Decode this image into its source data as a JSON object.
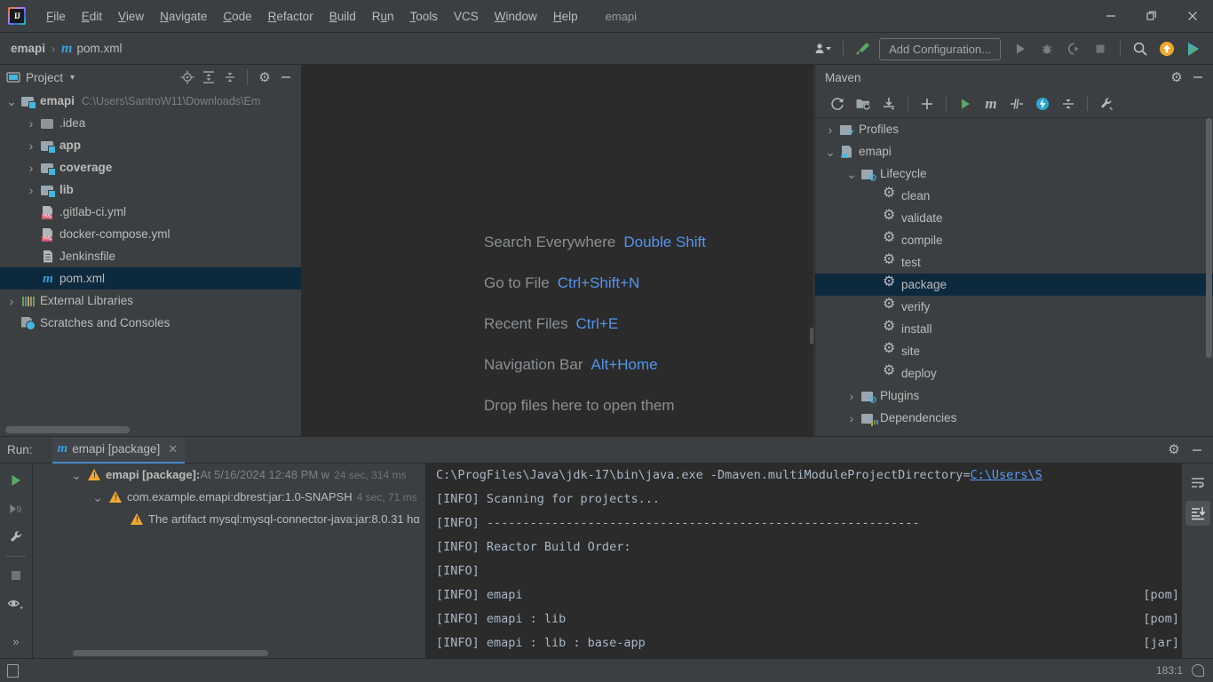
{
  "window": {
    "app_icon": "intellij-idea-logo",
    "project_name": "emapi",
    "menus": [
      {
        "label": "File",
        "accel": "F"
      },
      {
        "label": "Edit",
        "accel": "E"
      },
      {
        "label": "View",
        "accel": "V"
      },
      {
        "label": "Navigate",
        "accel": "N"
      },
      {
        "label": "Code",
        "accel": "C"
      },
      {
        "label": "Refactor",
        "accel": "R"
      },
      {
        "label": "Build",
        "accel": "B"
      },
      {
        "label": "Run",
        "accel": "u"
      },
      {
        "label": "Tools",
        "accel": "T"
      },
      {
        "label": "VCS",
        "accel": ""
      },
      {
        "label": "Window",
        "accel": "W"
      },
      {
        "label": "Help",
        "accel": "H"
      }
    ],
    "controls": {
      "minimize": "—",
      "restore": "❐",
      "close": "✕"
    }
  },
  "navbar": {
    "breadcrumb_root": "emapi",
    "breadcrumb_sep": "›",
    "breadcrumb_file": "pom.xml",
    "file_icon": "maven-file-icon",
    "add_configuration": "Add Configuration...",
    "icons": {
      "user": "user-dropdown-icon",
      "build": "build-hammer-icon",
      "run": "run-icon",
      "debug": "debug-icon",
      "run_coverage": "run-with-coverage-icon",
      "stop": "stop-icon",
      "search": "search-icon",
      "updates": "update-available-icon",
      "ide_feature": "ide-feature-trainer-icon"
    }
  },
  "project_panel": {
    "title": "Project",
    "dropdown": "▾",
    "actions": [
      "locate-icon",
      "expand-all-icon",
      "collapse-all-icon",
      "settings-gear-icon",
      "hide-icon"
    ],
    "tree": [
      {
        "label": "emapi",
        "hint": "C:\\Users\\SantroW11\\Downloads\\Em",
        "icon": "module-folder-icon",
        "indent": 0,
        "arrow": "expanded",
        "bold": true,
        "selected": false
      },
      {
        "label": ".idea",
        "hint": "",
        "icon": "folder-icon",
        "indent": 1,
        "arrow": "collapsed",
        "bold": false,
        "selected": false
      },
      {
        "label": "app",
        "hint": "",
        "icon": "module-folder-icon",
        "indent": 1,
        "arrow": "collapsed",
        "bold": true,
        "selected": false
      },
      {
        "label": "coverage",
        "hint": "",
        "icon": "module-folder-icon",
        "indent": 1,
        "arrow": "collapsed",
        "bold": true,
        "selected": false
      },
      {
        "label": "lib",
        "hint": "",
        "icon": "module-folder-icon",
        "indent": 1,
        "arrow": "collapsed",
        "bold": true,
        "selected": false
      },
      {
        "label": ".gitlab-ci.yml",
        "hint": "",
        "icon": "yml-file-icon",
        "indent": 1,
        "arrow": "none",
        "bold": false,
        "selected": false
      },
      {
        "label": "docker-compose.yml",
        "hint": "",
        "icon": "yml-file-icon",
        "indent": 1,
        "arrow": "none",
        "bold": false,
        "selected": false
      },
      {
        "label": "Jenkinsfile",
        "hint": "",
        "icon": "text-file-icon",
        "indent": 1,
        "arrow": "none",
        "bold": false,
        "selected": false
      },
      {
        "label": "pom.xml",
        "hint": "",
        "icon": "maven-file-icon",
        "indent": 1,
        "arrow": "none",
        "bold": false,
        "selected": true
      },
      {
        "label": "External Libraries",
        "hint": "",
        "icon": "libraries-icon",
        "indent": 0,
        "arrow": "collapsed",
        "bold": false,
        "selected": false
      },
      {
        "label": "Scratches and Consoles",
        "hint": "",
        "icon": "scratches-icon",
        "indent": 0,
        "arrow": "none",
        "bold": false,
        "selected": false
      }
    ]
  },
  "editor": {
    "tips": [
      {
        "label": "Search Everywhere",
        "key": "Double Shift"
      },
      {
        "label": "Go to File",
        "key": "Ctrl+Shift+N"
      },
      {
        "label": "Recent Files",
        "key": "Ctrl+E"
      },
      {
        "label": "Navigation Bar",
        "key": "Alt+Home"
      },
      {
        "label": "Drop files here to open them",
        "key": ""
      }
    ]
  },
  "maven_panel": {
    "title": "Maven",
    "header_actions": [
      "settings-gear-icon",
      "hide-icon"
    ],
    "toolbar": [
      "reload-all-maven-projects-icon",
      "add-maven-project-icon",
      "download-sources-icon",
      "add-icon",
      "run-icon",
      "execute-maven-goal-icon",
      "toggle-skip-tests-icon",
      "toggle-offline-mode-icon",
      "collapse-all-icon",
      "maven-settings-icon"
    ],
    "tree": [
      {
        "label": "Profiles",
        "icon": "profiles-icon",
        "indent": 0,
        "arrow": "collapsed",
        "selected": false
      },
      {
        "label": "emapi",
        "icon": "maven-module-icon",
        "indent": 0,
        "arrow": "expanded",
        "selected": false
      },
      {
        "label": "Lifecycle",
        "icon": "lifecycle-folder-icon",
        "indent": 1,
        "arrow": "expanded",
        "selected": false
      },
      {
        "label": "clean",
        "icon": "maven-goal-icon",
        "indent": 2,
        "arrow": "none",
        "selected": false
      },
      {
        "label": "validate",
        "icon": "maven-goal-icon",
        "indent": 2,
        "arrow": "none",
        "selected": false
      },
      {
        "label": "compile",
        "icon": "maven-goal-icon",
        "indent": 2,
        "arrow": "none",
        "selected": false
      },
      {
        "label": "test",
        "icon": "maven-goal-icon",
        "indent": 2,
        "arrow": "none",
        "selected": false
      },
      {
        "label": "package",
        "icon": "maven-goal-icon",
        "indent": 2,
        "arrow": "none",
        "selected": true
      },
      {
        "label": "verify",
        "icon": "maven-goal-icon",
        "indent": 2,
        "arrow": "none",
        "selected": false
      },
      {
        "label": "install",
        "icon": "maven-goal-icon",
        "indent": 2,
        "arrow": "none",
        "selected": false
      },
      {
        "label": "site",
        "icon": "maven-goal-icon",
        "indent": 2,
        "arrow": "none",
        "selected": false
      },
      {
        "label": "deploy",
        "icon": "maven-goal-icon",
        "indent": 2,
        "arrow": "none",
        "selected": false
      },
      {
        "label": "Plugins",
        "icon": "plugins-folder-icon",
        "indent": 1,
        "arrow": "collapsed",
        "selected": false
      },
      {
        "label": "Dependencies",
        "icon": "dependencies-folder-icon",
        "indent": 1,
        "arrow": "collapsed",
        "selected": false
      }
    ]
  },
  "run_panel": {
    "label": "Run:",
    "tab_title": "emapi [package]",
    "tab_icon": "maven-file-icon",
    "tab_close": "✕",
    "header_actions": [
      "settings-gear-icon",
      "hide-icon"
    ],
    "gutter_actions": [
      "rerun-icon",
      "rerun-failed-tests-icon",
      "settings-wrench-icon",
      "stop-icon",
      "show-passed-icon",
      "expand-more-icon"
    ],
    "tree": [
      {
        "indent": 0,
        "arrow": "expanded",
        "bold_text": "emapi [package]:",
        "normal_text": " At 5/16/2024 12:48 PM w",
        "dim_text": "24 sec, 314 ms"
      },
      {
        "indent": 1,
        "arrow": "expanded",
        "bold_text": "",
        "normal_text": "com.example.emapi:dbrest:jar:1.0-SNAPSH",
        "dim_text": "4 sec, 71 ms"
      },
      {
        "indent": 2,
        "arrow": "none",
        "bold_text": "",
        "normal_text": "The artifact mysql:mysql-connector-java:jar:8.0.31 hɑ",
        "dim_text": ""
      }
    ],
    "console_lines": [
      {
        "text": "C:\\ProgFiles\\Java\\jdk-17\\bin\\java.exe -Dmaven.multiModuleProjectDirectory=",
        "link": "C:\\Users\\S",
        "tag": ""
      },
      {
        "text": "[INFO] Scanning for projects...",
        "link": "",
        "tag": ""
      },
      {
        "text": "[INFO] ------------------------------------------------------------",
        "link": "",
        "tag": ""
      },
      {
        "text": "[INFO] Reactor Build Order:",
        "link": "",
        "tag": ""
      },
      {
        "text": "[INFO]",
        "link": "",
        "tag": ""
      },
      {
        "text": "[INFO] emapi",
        "link": "",
        "tag": "[pom]"
      },
      {
        "text": "[INFO] emapi : lib",
        "link": "",
        "tag": "[pom]"
      },
      {
        "text": "[INFO] emapi : lib : base-app",
        "link": "",
        "tag": "[jar]"
      }
    ],
    "console_side_actions": [
      "soft-wrap-icon",
      "scroll-to-end-icon"
    ]
  },
  "statusbar": {
    "left_icon": "toggle-tool-window-icon",
    "position": "183:1",
    "right_icon": "notifications-icon"
  },
  "colors": {
    "background": "#3c3f41",
    "editor_background": "#2b2b2b",
    "selection": "#0d293e",
    "accent_blue": "#4a88c7",
    "link": "#589df6",
    "key_hint": "#5394ec",
    "warning": "#f0a732",
    "maven_icon": "#389fd6",
    "run_green": "#59a869"
  }
}
